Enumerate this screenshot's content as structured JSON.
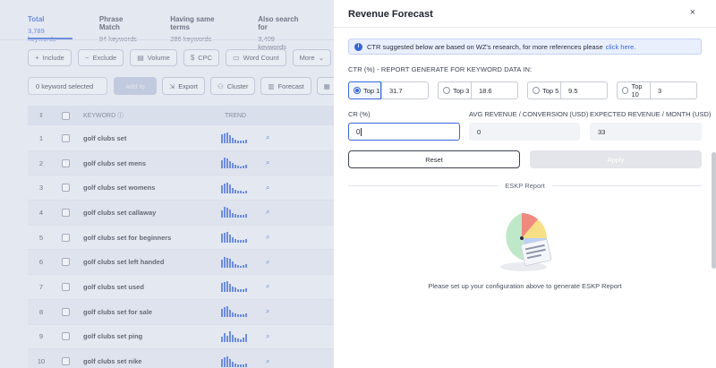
{
  "left": {
    "stats": [
      {
        "label": "Total",
        "value": "3,789 keywords",
        "active": true
      },
      {
        "label": "Phrase Match",
        "value": "94 keywords"
      },
      {
        "label": "Having same terms",
        "value": "286 keywords"
      },
      {
        "label": "Also search for",
        "value": "3,409 keywords"
      }
    ],
    "filters": [
      {
        "label": "Include",
        "icon": "plus-icon",
        "glyph": "+"
      },
      {
        "label": "Exclude",
        "icon": "minus-icon",
        "glyph": "−"
      },
      {
        "label": "Volume",
        "icon": "volume-icon",
        "glyph": "▤"
      },
      {
        "label": "CPC",
        "icon": "cpc-icon",
        "glyph": "$"
      },
      {
        "label": "Word Count",
        "icon": "word-count-icon",
        "glyph": "▭"
      },
      {
        "label": "More",
        "icon": "chevron-down-icon",
        "glyph": "⌄"
      }
    ],
    "selected_text": "0 keyword selected",
    "add_to_label": "Add to",
    "actions": [
      {
        "label": "Export",
        "icon": "export-icon",
        "glyph": "⇲"
      },
      {
        "label": "Cluster",
        "icon": "cluster-icon",
        "glyph": "⚇"
      },
      {
        "label": "Forecast",
        "icon": "forecast-icon",
        "glyph": "▥"
      },
      {
        "label": "",
        "icon": "more-icon",
        "glyph": "▦"
      }
    ],
    "table": {
      "col_keyword": "KEYWORD",
      "col_trend": "TREND",
      "rows": [
        {
          "num": "1",
          "keyword": "golf clubs set",
          "trend": [
            10,
            11,
            12,
            9,
            6,
            4,
            3,
            3,
            3,
            4
          ]
        },
        {
          "num": "2",
          "keyword": "golf clubs set mens",
          "trend": [
            9,
            12,
            11,
            8,
            6,
            4,
            3,
            2,
            3,
            4
          ]
        },
        {
          "num": "3",
          "keyword": "golf clubs set womens",
          "trend": [
            9,
            11,
            12,
            10,
            6,
            4,
            3,
            3,
            2,
            3
          ]
        },
        {
          "num": "4",
          "keyword": "golf clubs set callaway",
          "trend": [
            8,
            12,
            11,
            9,
            5,
            4,
            3,
            3,
            3,
            4
          ]
        },
        {
          "num": "5",
          "keyword": "golf clubs set for beginners",
          "trend": [
            10,
            11,
            12,
            9,
            6,
            4,
            3,
            3,
            3,
            4
          ]
        },
        {
          "num": "6",
          "keyword": "golf clubs set left handed",
          "trend": [
            9,
            12,
            11,
            10,
            7,
            4,
            3,
            2,
            3,
            4
          ]
        },
        {
          "num": "7",
          "keyword": "golf clubs set used",
          "trend": [
            10,
            11,
            12,
            9,
            6,
            5,
            3,
            3,
            3,
            4
          ]
        },
        {
          "num": "8",
          "keyword": "golf clubs set for sale",
          "trend": [
            9,
            11,
            12,
            8,
            5,
            4,
            3,
            3,
            3,
            4
          ]
        },
        {
          "num": "9",
          "keyword": "golf clubs set ping",
          "trend": [
            6,
            10,
            7,
            12,
            8,
            5,
            4,
            3,
            5,
            9
          ]
        },
        {
          "num": "10",
          "keyword": "golf clubs set nike",
          "trend": [
            9,
            11,
            12,
            9,
            6,
            4,
            3,
            3,
            3,
            4
          ]
        }
      ]
    }
  },
  "modal": {
    "title": "Revenue Forecast",
    "close_glyph": "×",
    "info_text": "CTR suggested below are based on WZ's research, for more references please",
    "info_link": "click here.",
    "ctr_label": "CTR (%) - REPORT GENERATE FOR KEYWORD DATA IN:",
    "ctr_options": [
      {
        "label": "Top 1",
        "value": "31.7",
        "selected": true
      },
      {
        "label": "Top 3",
        "value": "18.6"
      },
      {
        "label": "Top 5",
        "value": "9.5"
      },
      {
        "label": "Top 10",
        "value": "3"
      }
    ],
    "cr_label": "CR (%)",
    "cr_value": "0",
    "avg_label": "AVG REVENUE / CONVERSION (USD)",
    "avg_value": "0",
    "exp_label": "EXPECTED REVENUE / MONTH (USD)",
    "exp_value": "33",
    "reset_label": "Reset",
    "apply_label": "Apply",
    "section_title": "ESKP Report",
    "empty_message": "Please set up your configuration above to generate ESKP Report"
  },
  "colors": {
    "accent": "#3a67d8",
    "pie_green": "#bfe8c9",
    "pie_red": "#f08a7e",
    "pie_yellow": "#f7df86",
    "pie_blue": "#bcd0f5"
  }
}
